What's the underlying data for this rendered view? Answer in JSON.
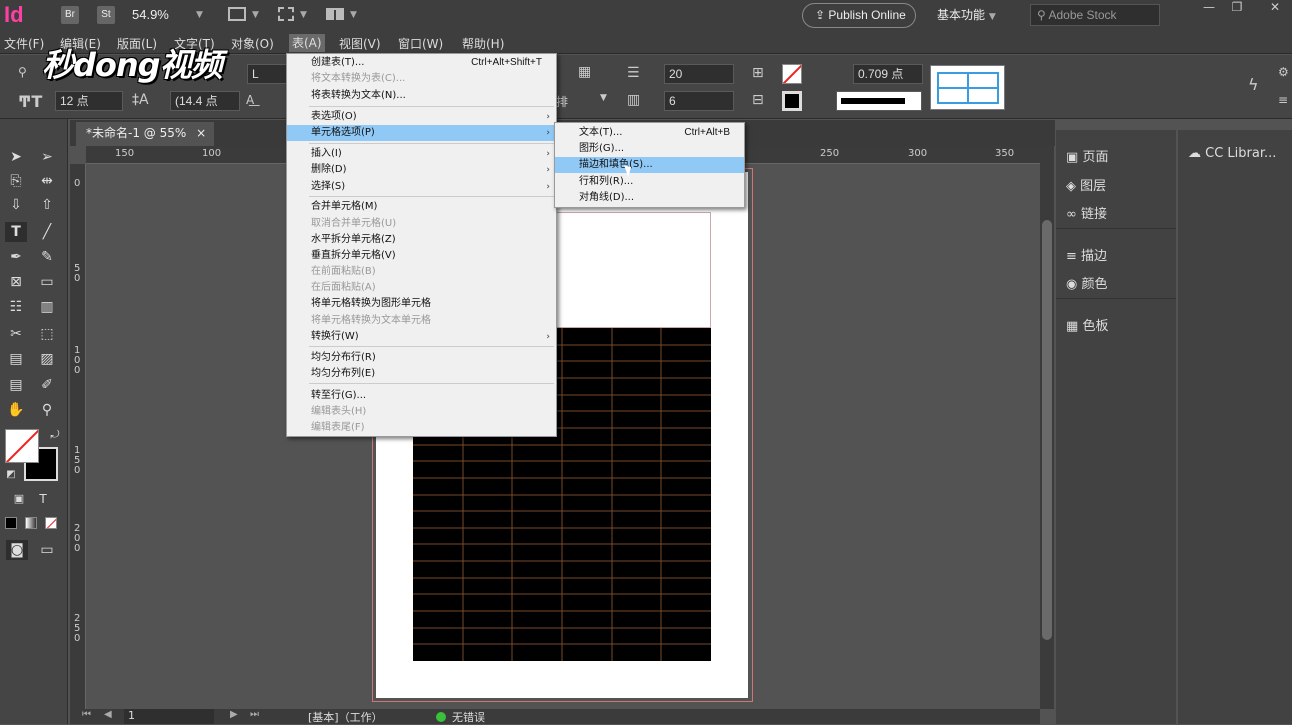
{
  "app": {
    "logo": "Id",
    "br_label": "Br",
    "st_label": "St",
    "zoom": "54.9%",
    "publish_label": "Publish Online",
    "workspace": "基本功能",
    "stock_placeholder": "Adobe Stock"
  },
  "watermark": "秒dong视频",
  "menubar": {
    "items": [
      "文件(F)",
      "编辑(E)",
      "版面(L)",
      "文字(T)",
      "对象(O)",
      "表(A)",
      "视图(V)",
      "窗口(W)",
      "帮助(H)"
    ]
  },
  "control": {
    "font_style": "L",
    "font_size": "12 点",
    "leading": "(14.4 点",
    "rows": "20",
    "cols": "6",
    "stroke_weight": "0.709 点",
    "align_label": "排"
  },
  "doc_tab": {
    "title": "*未命名-1 @ 55%",
    "close": "×"
  },
  "ruler": {
    "h_labels": [
      "150",
      "100",
      "250",
      "300",
      "350"
    ],
    "v_labels": [
      "0",
      "5\n0",
      "1\n0\n0",
      "1\n5\n0",
      "2\n0\n0",
      "2\n5\n0"
    ]
  },
  "menu_table": {
    "items": [
      {
        "label": "创建表(T)...",
        "shortcut": "Ctrl+Alt+Shift+T",
        "disabled": false
      },
      {
        "label": "将文本转换为表(C)...",
        "shortcut": "",
        "disabled": true
      },
      {
        "label": "将表转换为文本(N)...",
        "shortcut": "",
        "disabled": false
      },
      {
        "label": "表选项(O)",
        "submenu": true,
        "disabled": false
      },
      {
        "label": "单元格选项(P)",
        "submenu": true,
        "highlighted": true
      },
      {
        "label": "插入(I)",
        "submenu": true
      },
      {
        "label": "删除(D)",
        "submenu": true
      },
      {
        "label": "选择(S)",
        "submenu": true
      },
      {
        "label": "合并单元格(M)",
        "disabled": false
      },
      {
        "label": "取消合并单元格(U)",
        "disabled": true
      },
      {
        "label": "水平拆分单元格(Z)",
        "disabled": false
      },
      {
        "label": "垂直拆分单元格(V)",
        "disabled": false
      },
      {
        "label": "在前面粘贴(B)",
        "disabled": true
      },
      {
        "label": "在后面粘贴(A)",
        "disabled": true
      },
      {
        "label": "将单元格转换为图形单元格",
        "disabled": false
      },
      {
        "label": "将单元格转换为文本单元格",
        "disabled": true
      },
      {
        "label": "转换行(W)",
        "submenu": true
      },
      {
        "label": "均匀分布行(R)",
        "disabled": false
      },
      {
        "label": "均匀分布列(E)",
        "disabled": false
      },
      {
        "label": "转至行(G)...",
        "disabled": false
      },
      {
        "label": "编辑表头(H)",
        "disabled": true
      },
      {
        "label": "编辑表尾(F)",
        "disabled": true
      }
    ]
  },
  "menu_cell_options": {
    "items": [
      {
        "label": "文本(T)...",
        "shortcut": "Ctrl+Alt+B"
      },
      {
        "label": "图形(G)...",
        "shortcut": ""
      },
      {
        "label": "描边和填色(S)...",
        "shortcut": "",
        "highlighted": true
      },
      {
        "label": "行和列(R)...",
        "shortcut": ""
      },
      {
        "label": "对角线(D)...",
        "shortcut": ""
      }
    ]
  },
  "right_panel": {
    "items": [
      "页面",
      "图层",
      "链接",
      "描边",
      "颜色",
      "色板"
    ],
    "cc_label": "CC Librar..."
  },
  "status": {
    "page": "1",
    "master": "[基本]（工作）",
    "preflight": "无错误"
  },
  "colors": {
    "accent": "#90c8f6",
    "menu_bg": "#f0f0f0",
    "logo": "#ff3fa4",
    "preflight_ok": "#3ac03a"
  }
}
